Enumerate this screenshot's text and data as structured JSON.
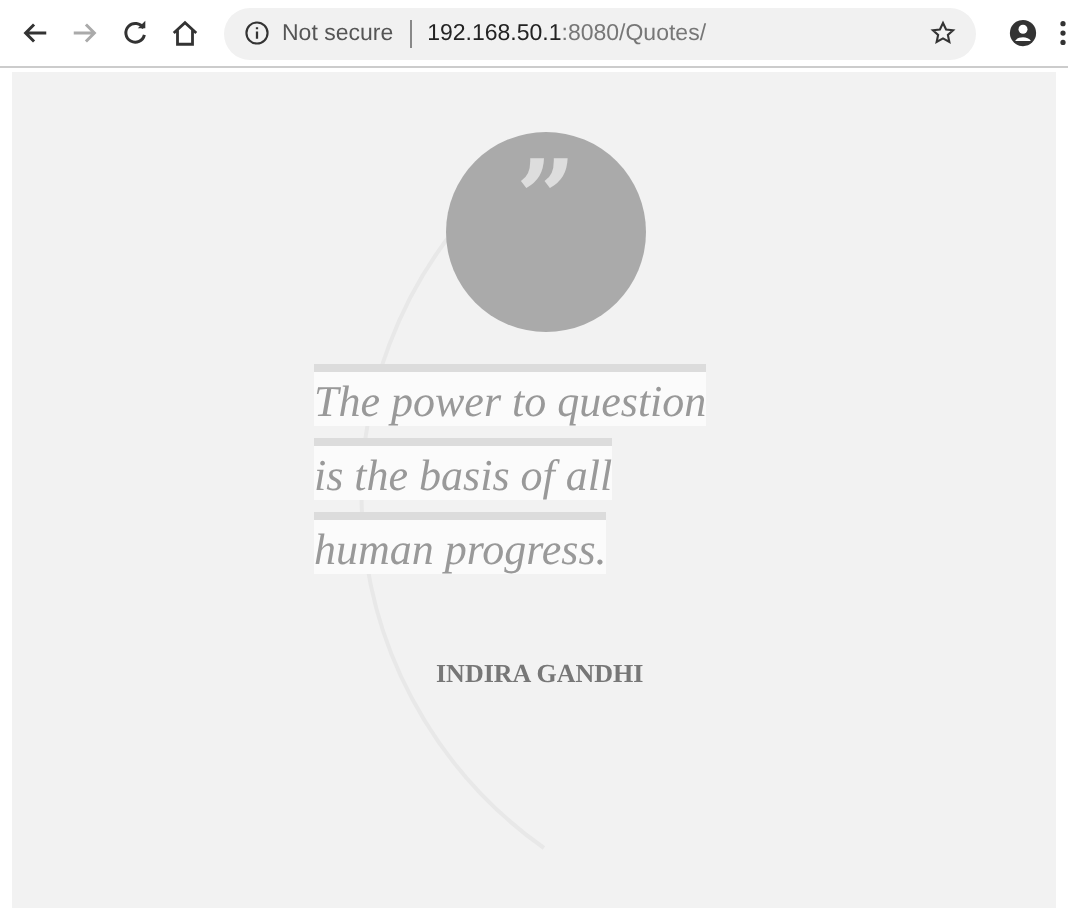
{
  "browser": {
    "security": "Not secure",
    "url_host": "192.168.50.1",
    "url_rest": ":8080/Quotes/",
    "back_disabled": false,
    "forward_disabled": true
  },
  "quote": {
    "mark": "”",
    "lines": [
      "The power to question",
      "is the basis of all",
      "human progress."
    ],
    "author": "INDIRA GANDHI"
  }
}
